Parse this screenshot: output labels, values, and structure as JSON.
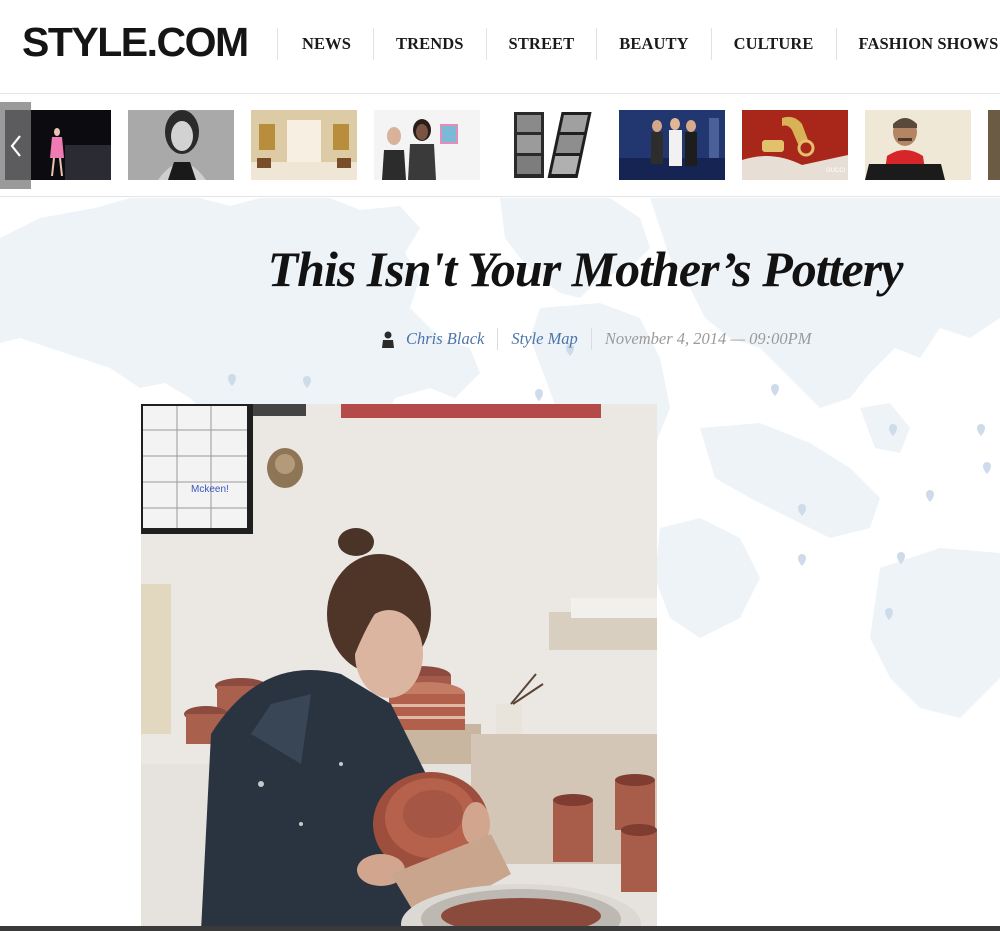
{
  "site": {
    "logo": "STYLE.COM"
  },
  "nav": {
    "items": [
      {
        "label": "NEWS"
      },
      {
        "label": "TRENDS"
      },
      {
        "label": "STREET"
      },
      {
        "label": "BEAUTY"
      },
      {
        "label": "CULTURE"
      },
      {
        "label": "FASHION SHOWS"
      }
    ]
  },
  "carousel": {
    "prev_icon": "chevron-left-icon",
    "thumbnails": [
      {
        "name": "runway-pink-dress"
      },
      {
        "name": "bw-portrait-model"
      },
      {
        "name": "gallery-interior"
      },
      {
        "name": "two-women-at-event"
      },
      {
        "name": "bw-photo-strip"
      },
      {
        "name": "party-group-blue"
      },
      {
        "name": "gucci-gold-horsebit"
      },
      {
        "name": "man-red-scarf"
      },
      {
        "name": "partial-thumbnail"
      }
    ]
  },
  "article": {
    "title": "This Isn't Your Mother’s Pottery",
    "author": "Chris Black",
    "section": "Style Map",
    "date": "November 4, 2014 — 09:00PM",
    "author_icon": "author-avatar-icon"
  },
  "colors": {
    "link": "#4a75a8",
    "date": "#9a9a9a",
    "map_land": "#eef3f8",
    "map_pin": "#cddbea"
  }
}
